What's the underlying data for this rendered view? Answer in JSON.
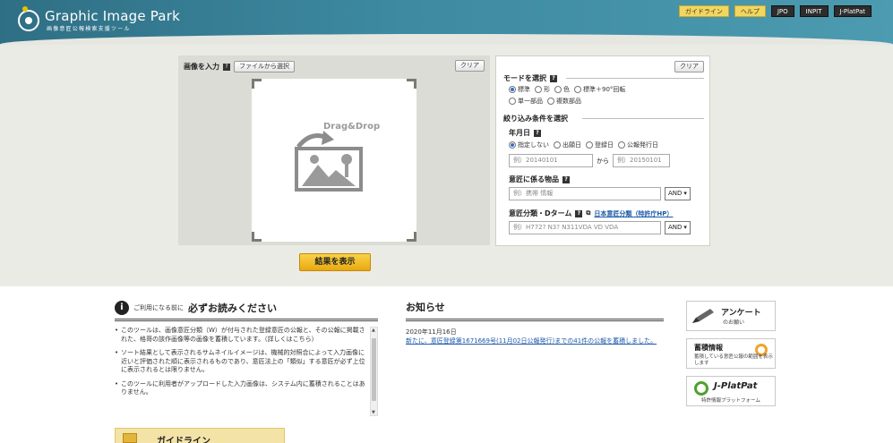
{
  "header": {
    "logo_title": "Graphic Image Park",
    "logo_sub": "画像意匠公報検索支援ツール",
    "nav": [
      "ガイドライン",
      "ヘルプ",
      "JPO",
      "INPIT",
      "J-PlatPat"
    ]
  },
  "upload": {
    "label": "画像を入力",
    "help": "?",
    "file_button": "ファイルから選択",
    "clear": "クリア",
    "drop_text": "Drag&Drop",
    "show_results": "結果を表示"
  },
  "filter": {
    "clear": "クリア",
    "mode_title": "モードを選択",
    "modes": [
      "標準",
      "形",
      "色",
      "標準＋90°回転",
      "単一部品",
      "複数部品"
    ],
    "narrow_title": "絞り込み条件を選択",
    "date_title": "年月日",
    "date_options": [
      "指定しない",
      "出願日",
      "登録日",
      "公報発行日"
    ],
    "date_from_placeholder": "例）20140101",
    "date_to_label": "から",
    "date_to_placeholder": "例）20150101",
    "article_title": "意匠に係る物品",
    "article_placeholder": "例）携帯 情報",
    "and1": "AND",
    "class_title": "意匠分類・Dターム",
    "class_link": "日本意匠分類（特許庁HP）",
    "class_placeholder": "例）H772? N3? N311VDA VD VDA",
    "and2": "AND"
  },
  "notice": {
    "icon": "i",
    "pre": "ご利用になる前に",
    "main": "必ずお読みください",
    "items": [
      "このツールは、画像意匠分類（W）が付与された登録意匠の公報と、その公報に掲載された、格哥の該作画像等の画像を蓄積しています。（詳しくはこちら）",
      "ソート結果として表示されるサムネイルイメージは、機械的対照合によって入力画像に近いと評価された順に表示されるものであり、意匠法上の「類似」する意匠が必ず上位に表示されるとは限りません。",
      "このツールに利用者がアップロードした入力画像は、システム内に蓄積されることはありません。"
    ]
  },
  "guide_tab": "ガイドライン",
  "news": {
    "title": "お知らせ",
    "date": "2020年11月16日",
    "link_text": "新たに、意匠登録第1671669号(11月02日公報発行)までの41件の公報を蓄積しました。"
  },
  "cards": {
    "survey_title": "アンケート",
    "survey_sub": "のお願い",
    "stock_title": "蓄積情報",
    "stock_sub": "蓄積している意匠公報の範囲を表示します",
    "jpp_title": "J-PlatPat",
    "jpp_sub": "特許情報プラットフォーム"
  }
}
